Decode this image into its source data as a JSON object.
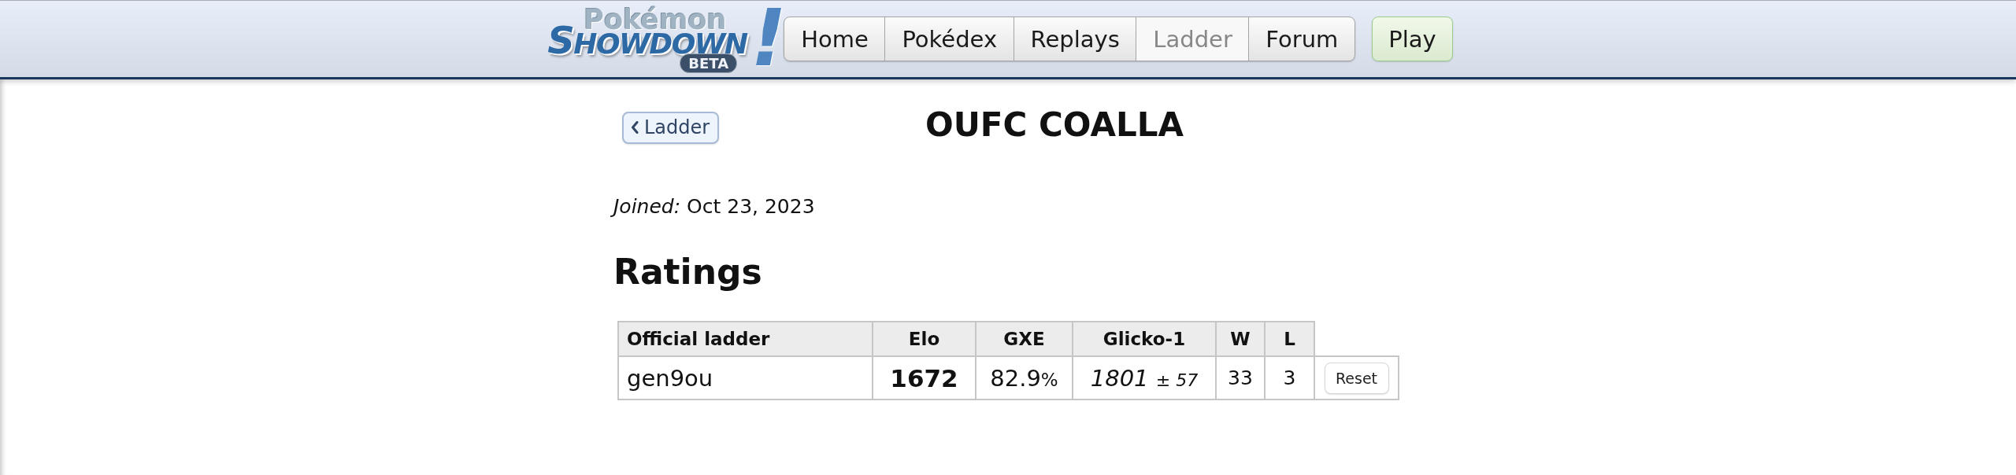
{
  "header": {
    "logo": {
      "subtitle": "Pokémon",
      "wordmark": "SHOWDOWN",
      "mark": "!",
      "badge": "BETA"
    },
    "nav": [
      {
        "label": "Home",
        "selected": false
      },
      {
        "label": "Pokédex",
        "selected": false
      },
      {
        "label": "Replays",
        "selected": false
      },
      {
        "label": "Ladder",
        "selected": true
      },
      {
        "label": "Forum",
        "selected": false
      }
    ],
    "play_button": "Play"
  },
  "profile": {
    "back_button": "Ladder",
    "name": "OUFC COALLA",
    "joined": "*Joined:* Oct 23, 2023"
  },
  "ratings": {
    "heading": "Ratings",
    "columns": [
      "Official ladder",
      "Elo",
      "GXE",
      "Glicko-1",
      "W",
      "L"
    ],
    "rows": [
      {
        "format": "gen9ou",
        "elo": "1672",
        "gxe": "82.9",
        "gxe_unit": "%",
        "glicko": "1801",
        "deviation": "± *57*",
        "wins": "33",
        "losses": "3",
        "action": "Reset"
      }
    ]
  }
}
